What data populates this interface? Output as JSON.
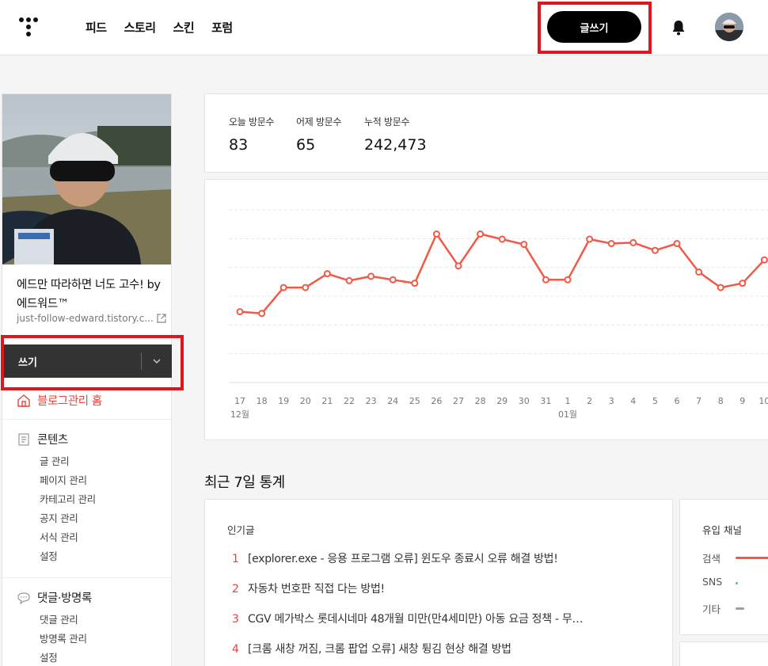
{
  "header": {
    "nav": [
      "피드",
      "스토리",
      "스킨",
      "포럼"
    ],
    "write_label": "글쓰기"
  },
  "sidebar": {
    "blog_title": "에드만 따라하면 너도 고수! by 에드워드™",
    "blog_url": "just-follow-edward.tistory.c...",
    "write_label": "쓰기",
    "home_label": "블로그관리 홈",
    "sections": [
      {
        "title": "콘텐츠",
        "items": [
          "글 관리",
          "페이지 관리",
          "카테고리 관리",
          "공지 관리",
          "서식 관리",
          "설정"
        ]
      },
      {
        "title": "댓글·방명록",
        "items": [
          "댓글 관리",
          "방명록 관리",
          "설정"
        ]
      }
    ]
  },
  "stats": {
    "today_label": "오늘 방문수",
    "today_value": "83",
    "yesterday_label": "어제 방문수",
    "yesterday_value": "65",
    "total_label": "누적 방문수",
    "total_value": "242,473"
  },
  "chart_data": {
    "type": "line",
    "x": [
      "17",
      "18",
      "19",
      "20",
      "21",
      "22",
      "23",
      "24",
      "25",
      "26",
      "27",
      "28",
      "29",
      "30",
      "31",
      "1",
      "2",
      "3",
      "4",
      "5",
      "6",
      "7",
      "8",
      "9",
      "10"
    ],
    "month_labels": [
      {
        "index": 0,
        "label": "12월"
      },
      {
        "index": 15,
        "label": "01월"
      }
    ],
    "values": [
      82,
      80,
      110,
      110,
      126,
      118,
      123,
      119,
      115,
      172,
      135,
      172,
      166,
      160,
      119,
      119,
      166,
      161,
      162,
      153,
      161,
      128,
      110,
      115,
      142
    ],
    "ylim": [
      0,
      200
    ],
    "grid": true,
    "color": "#f05a46"
  },
  "recent": {
    "title": "최근 7일 통계",
    "popular_title": "인기글",
    "popular": [
      {
        "rank": "1",
        "text": "[explorer.exe - 응용 프로그램 오류] 윈도우 종료시 오류 해결 방법!"
      },
      {
        "rank": "2",
        "text": "자동차 번호판 직접 다는 방법!"
      },
      {
        "rank": "3",
        "text": "CGV 메가박스 롯데시네마 48개월 미만(만4세미만) 아동 요금 정책 - 무…"
      },
      {
        "rank": "4",
        "text": "[크롬 새창 꺼짐, 크롬 팝업 오류] 새창 튕김 현상 해결 방법"
      }
    ],
    "channel_title": "유입 채널",
    "channels": [
      {
        "name": "검색",
        "share": 0.85,
        "color": "#f05a46"
      },
      {
        "name": "SNS",
        "share": 0.03,
        "color": "#3ec4b5"
      },
      {
        "name": "기타",
        "share": 0.12,
        "color": "#9aa0a6"
      }
    ]
  }
}
